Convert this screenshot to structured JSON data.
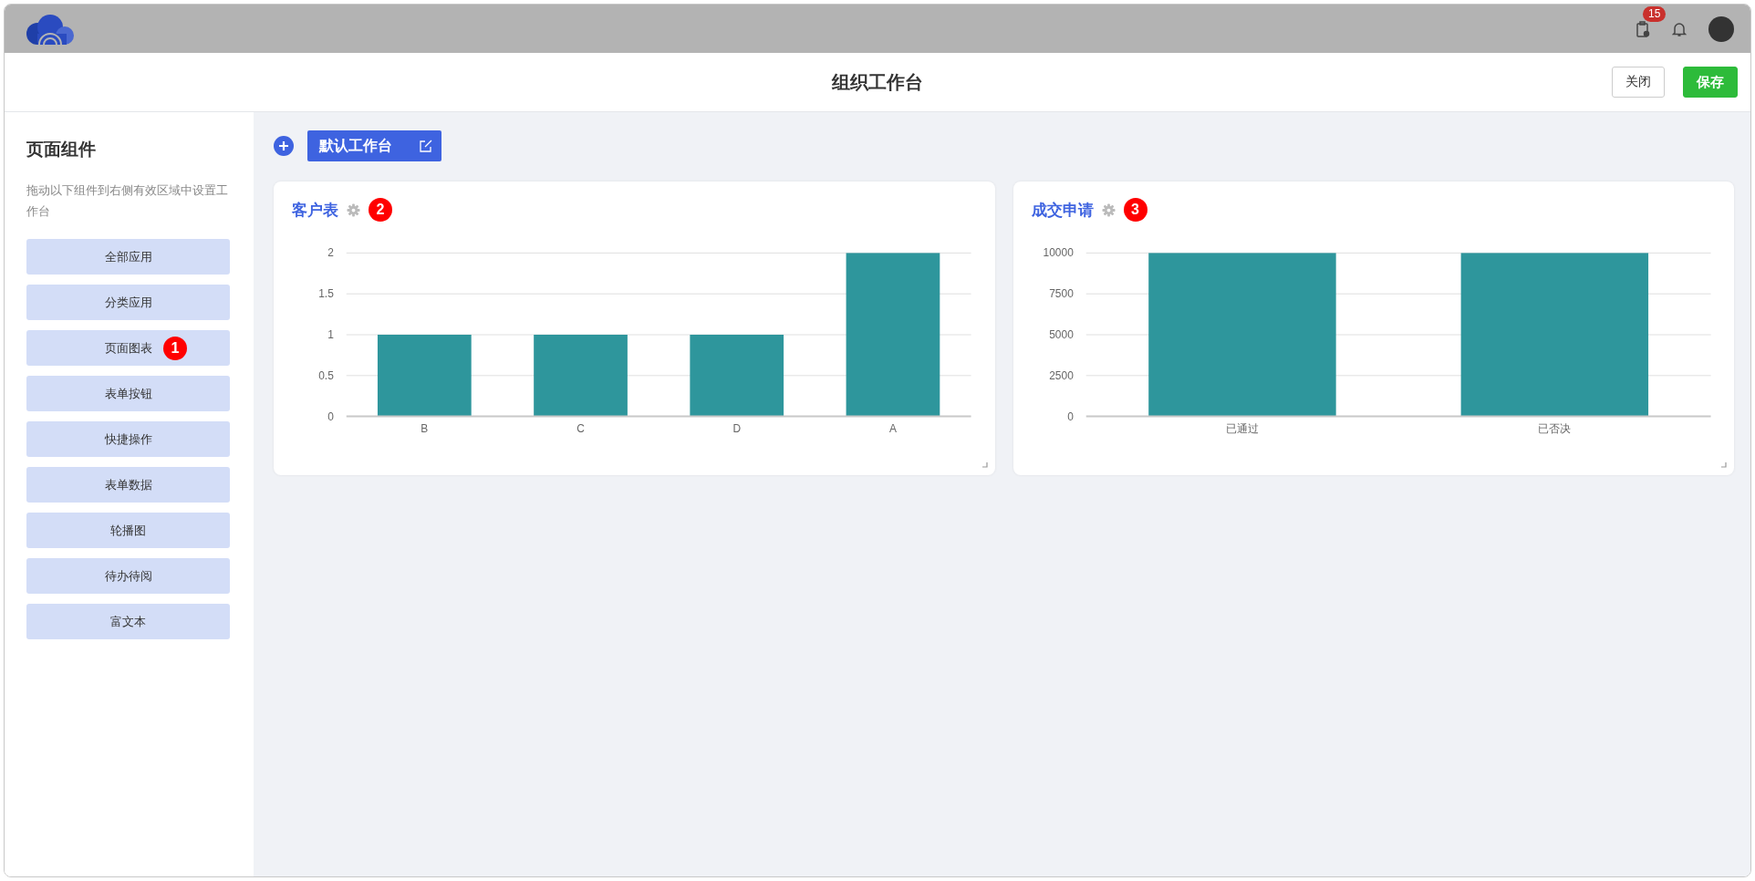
{
  "topbar": {
    "notification_count": "15"
  },
  "header": {
    "title": "组织工作台",
    "buttons": [
      {
        "label": "关闭",
        "kind": "plain"
      },
      {
        "label": "保存",
        "kind": "primary"
      }
    ]
  },
  "sidebar": {
    "title": "页面组件",
    "hint": "拖动以下组件到右侧有效区域中设置工作台",
    "items": [
      {
        "label": "全部应用"
      },
      {
        "label": "分类应用"
      },
      {
        "label": "页面图表",
        "marker": "1"
      },
      {
        "label": "表单按钮"
      },
      {
        "label": "快捷操作"
      },
      {
        "label": "表单数据"
      },
      {
        "label": "轮播图"
      },
      {
        "label": "待办待阅"
      },
      {
        "label": "富文本"
      }
    ]
  },
  "workspace_tab": {
    "label": "默认工作台"
  },
  "cards": [
    {
      "title": "客户表",
      "marker": "2",
      "chart_data": {
        "type": "bar",
        "categories": [
          "B",
          "C",
          "D",
          "A"
        ],
        "series": [
          {
            "color": "#2e969c",
            "values": [
              1,
              1,
              1,
              2
            ]
          }
        ],
        "grid": true,
        "ylim": [
          0,
          2
        ],
        "yticks": [
          0,
          0.5,
          1,
          1.5,
          2
        ]
      }
    },
    {
      "title": "成交申请",
      "marker": "3",
      "chart_data": {
        "type": "bar",
        "categories": [
          "已通过",
          "已否决"
        ],
        "series": [
          {
            "color": "#2e969c",
            "values": [
              10000,
              10000
            ]
          }
        ],
        "grid": true,
        "ylim": [
          0,
          10000
        ],
        "yticks": [
          0,
          2500,
          5000,
          7500,
          10000
        ]
      }
    }
  ]
}
